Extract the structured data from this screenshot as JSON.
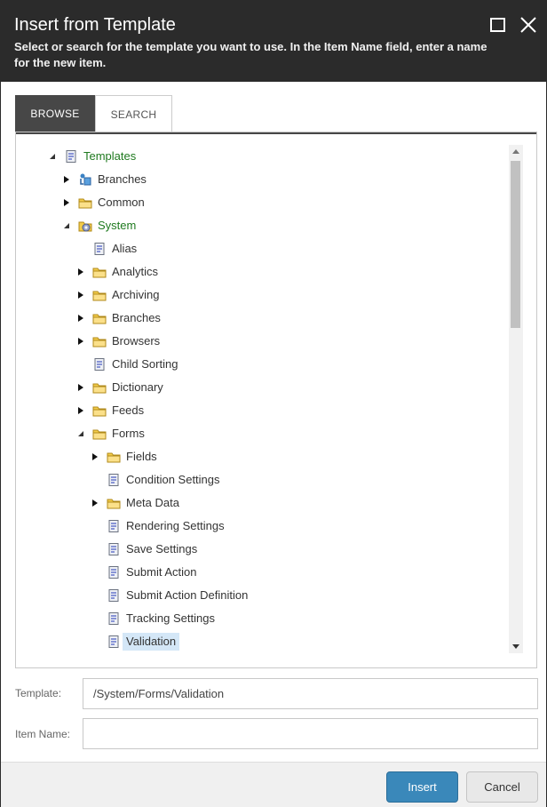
{
  "dialog": {
    "title": "Insert from Template",
    "description": "Select or search for the template you want to use. In the Item Name field, enter a name for the new item."
  },
  "tabs": [
    {
      "label": "BROWSE",
      "active": true
    },
    {
      "label": "SEARCH",
      "active": false
    }
  ],
  "tree": {
    "nodes": [
      {
        "label": "Templates",
        "icon": "template-icon",
        "expander": "expanded",
        "highlight": "green",
        "depth": 0
      },
      {
        "label": "Branches",
        "icon": "branch-icon",
        "expander": "collapsed",
        "depth": 1
      },
      {
        "label": "Common",
        "icon": "folder-icon",
        "expander": "collapsed",
        "depth": 1
      },
      {
        "label": "System",
        "icon": "system-folder-icon",
        "expander": "expanded",
        "highlight": "green",
        "depth": 1
      },
      {
        "label": "Alias",
        "icon": "template-icon",
        "expander": "none",
        "depth": 2
      },
      {
        "label": "Analytics",
        "icon": "folder-icon",
        "expander": "collapsed",
        "depth": 2
      },
      {
        "label": "Archiving",
        "icon": "folder-icon",
        "expander": "collapsed",
        "depth": 2
      },
      {
        "label": "Branches",
        "icon": "folder-icon",
        "expander": "collapsed",
        "depth": 2
      },
      {
        "label": "Browsers",
        "icon": "folder-icon",
        "expander": "collapsed",
        "depth": 2
      },
      {
        "label": "Child Sorting",
        "icon": "template-icon",
        "expander": "none",
        "depth": 2
      },
      {
        "label": "Dictionary",
        "icon": "folder-icon",
        "expander": "collapsed",
        "depth": 2
      },
      {
        "label": "Feeds",
        "icon": "folder-icon",
        "expander": "collapsed",
        "depth": 2
      },
      {
        "label": "Forms",
        "icon": "folder-icon",
        "expander": "expanded",
        "depth": 2
      },
      {
        "label": "Fields",
        "icon": "folder-icon",
        "expander": "collapsed",
        "depth": 3
      },
      {
        "label": "Condition Settings",
        "icon": "template-icon",
        "expander": "none",
        "depth": 3
      },
      {
        "label": "Meta Data",
        "icon": "folder-icon",
        "expander": "collapsed",
        "depth": 3
      },
      {
        "label": "Rendering Settings",
        "icon": "template-icon",
        "expander": "none",
        "depth": 3
      },
      {
        "label": "Save Settings",
        "icon": "template-icon",
        "expander": "none",
        "depth": 3
      },
      {
        "label": "Submit Action",
        "icon": "template-icon",
        "expander": "none",
        "depth": 3
      },
      {
        "label": "Submit Action Definition",
        "icon": "template-icon",
        "expander": "none",
        "depth": 3
      },
      {
        "label": "Tracking Settings",
        "icon": "template-icon",
        "expander": "none",
        "depth": 3
      },
      {
        "label": "Validation",
        "icon": "template-icon",
        "expander": "none",
        "depth": 3,
        "selected": true
      }
    ]
  },
  "fields": {
    "template_label": "Template:",
    "template_value": "/System/Forms/Validation",
    "item_name_label": "Item Name:",
    "item_name_value": ""
  },
  "buttons": {
    "insert": "Insert",
    "cancel": "Cancel"
  },
  "colors": {
    "header_bg": "#2b2b2b",
    "active_tab_bg": "#474747",
    "primary_button": "#3a88ba",
    "selected_row": "#d4e7f7",
    "green_text": "#1f7a1f"
  }
}
